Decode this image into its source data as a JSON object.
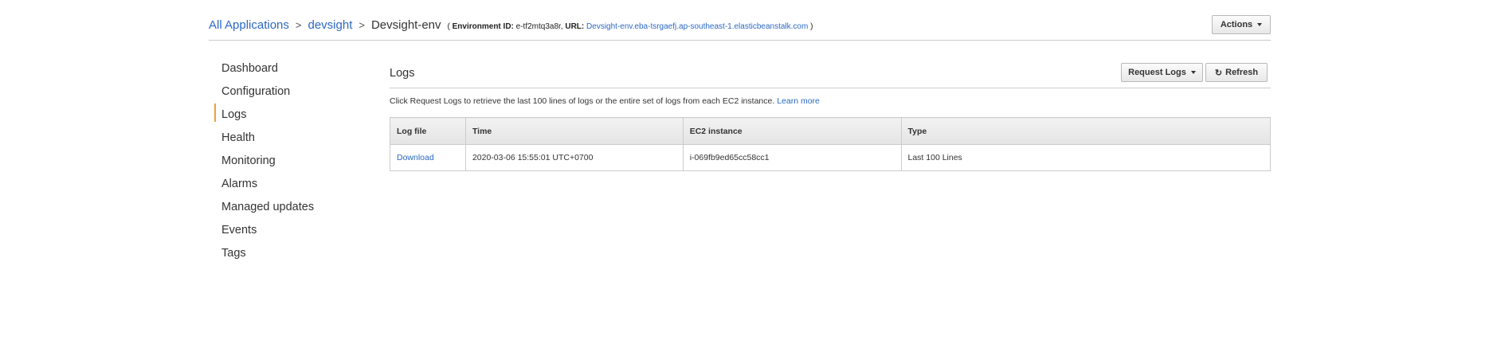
{
  "breadcrumb": {
    "all_applications": "All Applications",
    "application": "devsight",
    "environment": "Devsight-env",
    "separator": ">",
    "env_id_label": "Environment ID:",
    "env_id": "e-tf2mtq3a8r,",
    "url_label": "URL:",
    "url": "Devsight-env.eba-tsrgaefj.ap-southeast-1.elasticbeanstalk.com",
    "open_paren": "(",
    "close_paren": ")"
  },
  "header": {
    "actions_label": "Actions"
  },
  "sidebar": {
    "items": [
      {
        "label": "Dashboard"
      },
      {
        "label": "Configuration"
      },
      {
        "label": "Logs"
      },
      {
        "label": "Health"
      },
      {
        "label": "Monitoring"
      },
      {
        "label": "Alarms"
      },
      {
        "label": "Managed updates"
      },
      {
        "label": "Events"
      },
      {
        "label": "Tags"
      }
    ],
    "active": "Logs"
  },
  "main": {
    "title": "Logs",
    "request_logs_label": "Request Logs",
    "refresh_label": "Refresh",
    "description": "Click Request Logs to retrieve the last 100 lines of logs or the entire set of logs from each EC2 instance.",
    "learn_more": "Learn more",
    "table": {
      "columns": [
        "Log file",
        "Time",
        "EC2 instance",
        "Type"
      ],
      "rows": [
        {
          "log_file": "Download",
          "time": "2020-03-06 15:55:01 UTC+0700",
          "ec2_instance": "i-069fb9ed65cc58cc1",
          "type": "Last 100 Lines"
        }
      ]
    }
  },
  "colors": {
    "link": "#2c69c4",
    "active_indicator": "#f2a033",
    "border": "#cccccc"
  }
}
